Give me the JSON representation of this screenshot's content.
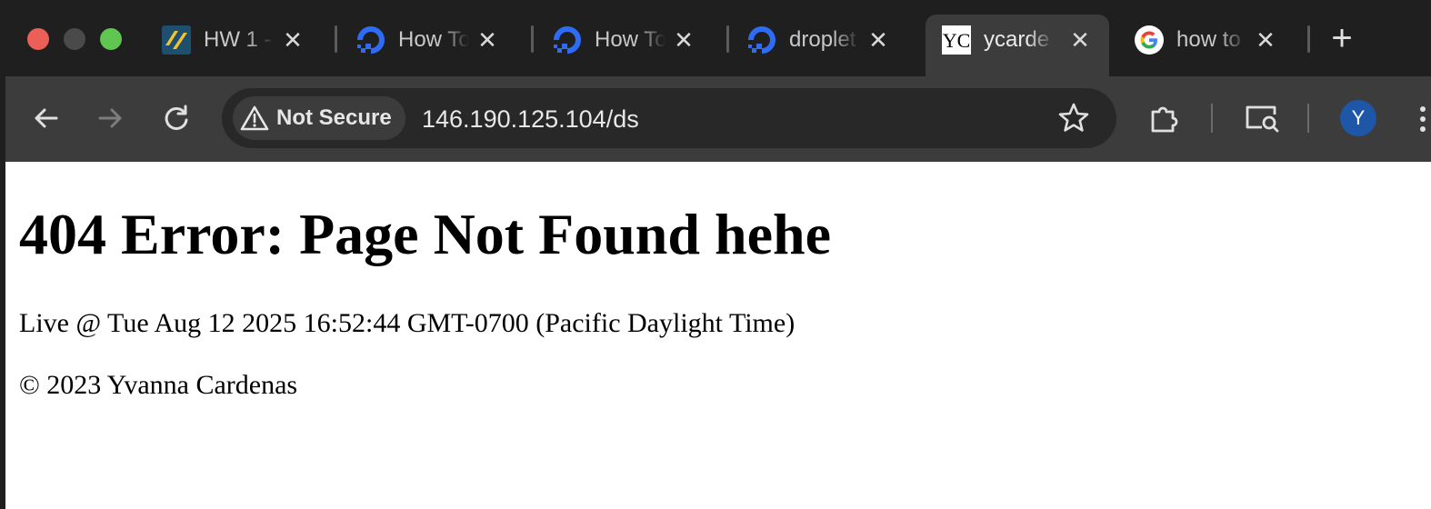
{
  "window": {
    "traffic_lights": [
      {
        "name": "close",
        "color": "#ec5f57"
      },
      {
        "name": "minimize",
        "color": "#4a4a4a"
      },
      {
        "name": "maximize",
        "color": "#5fc650"
      }
    ]
  },
  "tabs": [
    {
      "title": "HW 1 -",
      "favicon": "hw-doc-icon",
      "active": false
    },
    {
      "title": "How To",
      "favicon": "digitalocean-icon",
      "active": false
    },
    {
      "title": "How To",
      "favicon": "digitalocean-icon",
      "active": false
    },
    {
      "title": "droplet",
      "favicon": "digitalocean-icon",
      "active": false
    },
    {
      "title": "ycarde",
      "favicon": "yc-monogram-icon",
      "active": true
    },
    {
      "title": "how to",
      "favicon": "google-icon",
      "active": false
    }
  ],
  "tab_close_glyph": "✕",
  "new_tab_glyph": "+",
  "toolbar": {
    "back_icon": "arrow-left-icon",
    "forward_icon": "arrow-right-icon",
    "reload_icon": "reload-icon",
    "security_label": "Not Secure",
    "url": "146.190.125.104/ds",
    "bookmark_icon": "star-icon",
    "extensions_icon": "puzzle-icon",
    "cast_icon": "search-screen-icon",
    "profile_initial": "Y",
    "menu_icon": "kebab-menu-icon"
  },
  "page": {
    "heading": "404 Error: Page Not Found hehe",
    "live_text": "Live @ Tue Aug 12 2025 16:52:44 GMT-0700 (Pacific Daylight Time)",
    "copyright": "© 2023 Yvanna Cardenas"
  },
  "colors": {
    "tabstrip_bg": "#1f1f1f",
    "toolbar_bg": "#3c3c3c",
    "omnibox_bg": "#282828",
    "avatar_bg": "#1e56a8",
    "digitalocean_blue": "#2f6cf6"
  }
}
